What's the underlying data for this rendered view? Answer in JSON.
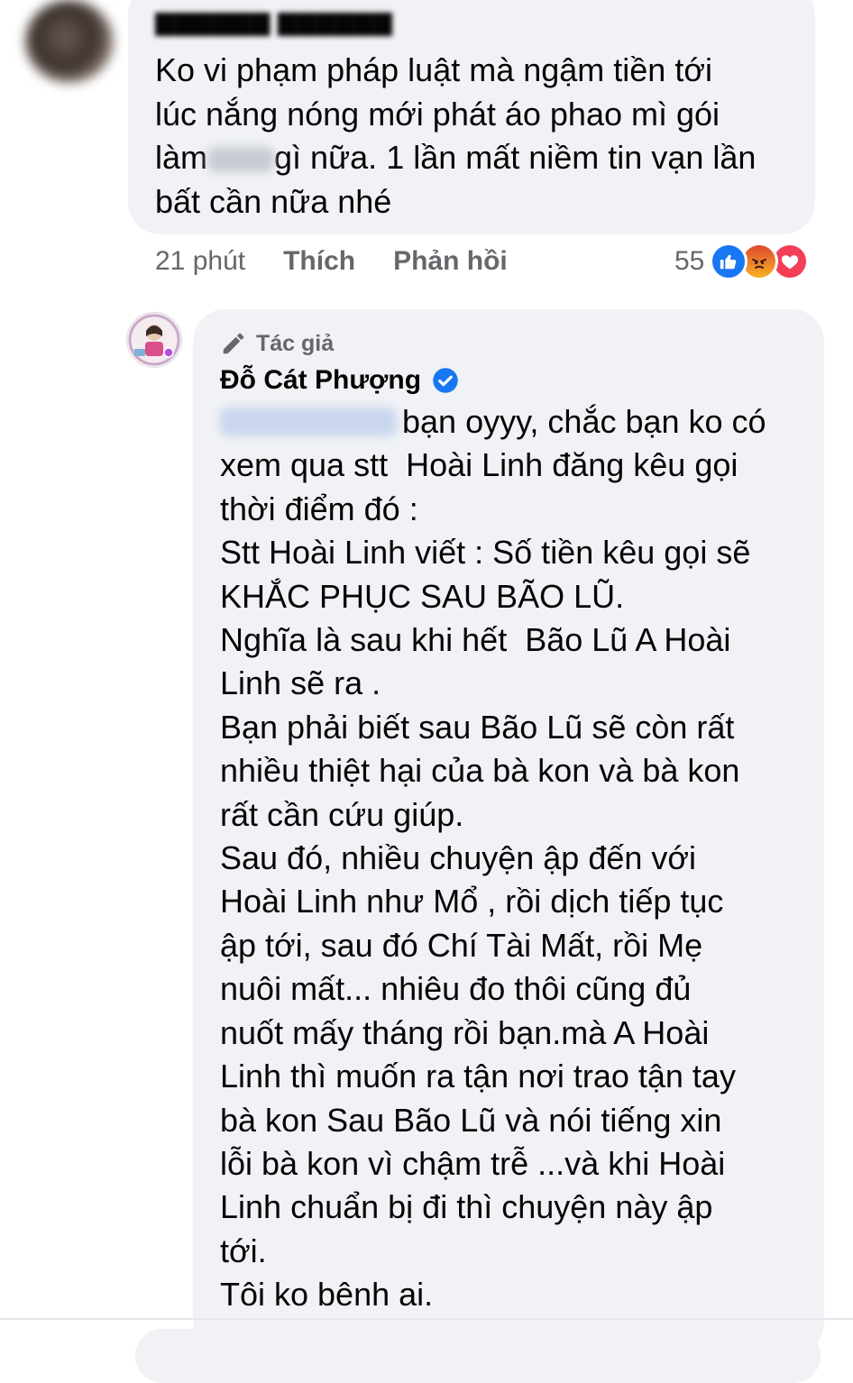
{
  "comment1": {
    "text_part1": "Ko vi phạm pháp luật mà ngậm tiền tới\nlúc nắng nóng mới phát áo phao mì gói\nlàm",
    "text_part2": "gì nữa. 1 lần mất niềm tin vạn lần\nbất cần nữa nhé",
    "time": "21 phút",
    "like_label": "Thích",
    "reply_label": "Phản hồi",
    "reaction_count": "55",
    "reaction_icons": [
      "like-icon",
      "angry-icon",
      "love-icon"
    ]
  },
  "reply": {
    "author_badge": "Tác giả",
    "author_name": "Đỗ Cát Phượng",
    "verified_icon": "verified-badge-icon",
    "first_line": "bạn oyyy, chắc bạn ko có",
    "lines": [
      "xem qua stt  Hoài Linh đăng kêu gọi",
      "thời điểm đó :",
      "Stt Hoài Linh viết : Số tiền kêu gọi sẽ",
      "KHẮC PHỤC SAU BÃO LŨ.",
      "Nghĩa là sau khi hết  Bão Lũ A Hoài",
      "Linh sẽ ra .",
      "Bạn phải biết sau Bão Lũ sẽ còn rất",
      "nhiều thiệt hại của bà kon và bà kon",
      "rất cần cứu giúp.",
      "Sau đó, nhiều chuyện ập đến với",
      "Hoài Linh như Mổ , rồi dịch tiếp tục",
      "ập tới, sau đó Chí Tài Mất, rồi Mẹ",
      "nuôi mất... nhiêu đo thôi cũng đủ",
      "nuốt mấy tháng rồi bạn.mà A Hoài",
      "Linh thì muốn ra tận nơi trao tận tay",
      "bà kon Sau Bão Lũ và nói tiếng xin",
      "lỗi bà kon vì chậm trễ ...và khi Hoài",
      "Linh chuẩn bị đi thì chuyện này ập",
      "tới.",
      "Tôi ko bênh ai."
    ]
  },
  "colors": {
    "bubble": "#f0f2f5",
    "meta_text": "#65676b",
    "like_blue": "#1877f2",
    "love_red": "#f33e58"
  }
}
